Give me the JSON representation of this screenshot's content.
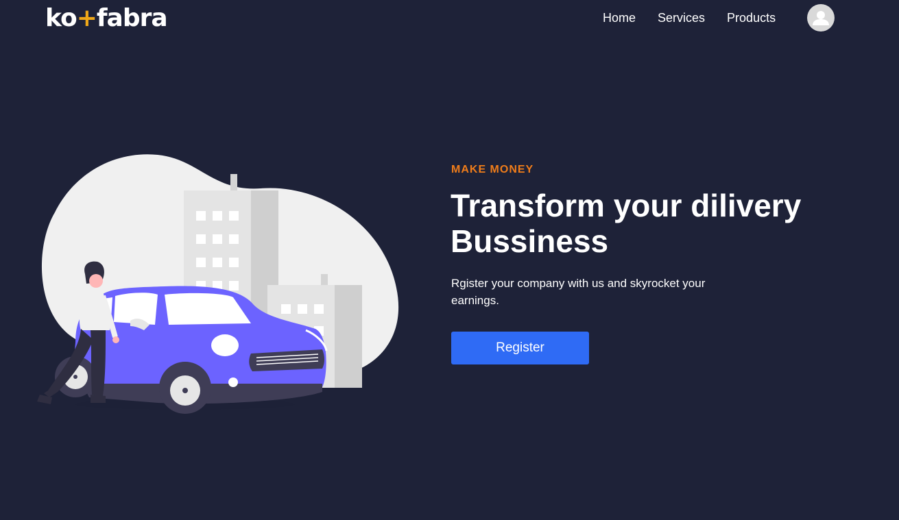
{
  "brand": {
    "logo_left": "ko",
    "logo_mark": "+",
    "logo_right": "fabra"
  },
  "nav": {
    "items": [
      {
        "label": "Home"
      },
      {
        "label": "Services"
      },
      {
        "label": "Products"
      }
    ]
  },
  "hero": {
    "eyebrow": "MAKE MONEY",
    "headline": "Transform your dilivery Bussiness",
    "subtext": "Rgister your company with us and skyrocket your earnings.",
    "cta_label": "Register"
  },
  "colors": {
    "background": "#1e2238",
    "accent": "#f07d1a",
    "button": "#2f6bf5",
    "car": "#6c63ff",
    "logo_mark": "#f0a818"
  },
  "icons": {
    "avatar": "user-avatar-icon"
  }
}
